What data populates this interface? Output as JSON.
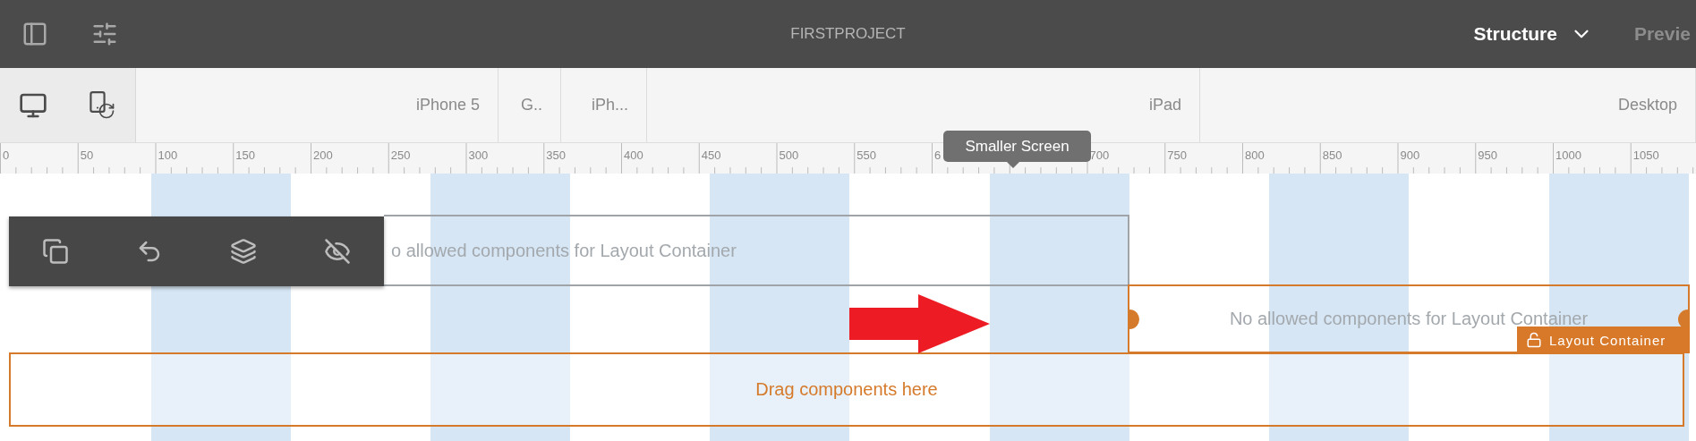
{
  "top_bar": {
    "title": "FIRSTPROJECT",
    "mode": "Structure",
    "next_mode": "Previe"
  },
  "device_bar": {
    "breakpoints": [
      {
        "label": "iPhone 5"
      },
      {
        "label": "G.."
      },
      {
        "label": "iPh..."
      },
      {
        "label": "iPad"
      },
      {
        "label": "Desktop"
      }
    ]
  },
  "ruler": {
    "labels": [
      "0",
      "50",
      "100",
      "150",
      "200",
      "250",
      "300",
      "350",
      "400",
      "450",
      "500",
      "550",
      "6"
    ],
    "labels_after_tooltip": [
      "700",
      "750",
      "800",
      "850",
      "900",
      "950",
      "1000",
      "1050"
    ]
  },
  "tooltip": "Smaller Screen",
  "canvas": {
    "containers": [
      {
        "kind": "inactive",
        "text": "o allowed components for Layout Container"
      },
      {
        "kind": "selected",
        "text": "No allowed components for Layout Container",
        "badge": "Layout Container"
      },
      {
        "kind": "dropzone",
        "text": "Drag components here"
      }
    ]
  }
}
